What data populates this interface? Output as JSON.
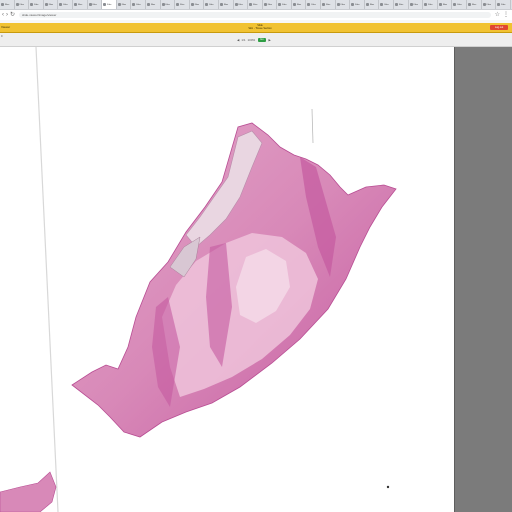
{
  "browser": {
    "tabs": [
      {
        "title": "Files",
        "active": false
      },
      {
        "title": "Files",
        "active": false
      },
      {
        "title": "Files",
        "active": false
      },
      {
        "title": "Files",
        "active": false
      },
      {
        "title": "Files",
        "active": false
      },
      {
        "title": "Files",
        "active": false
      },
      {
        "title": "Files",
        "active": false
      },
      {
        "title": "Files",
        "active": true
      },
      {
        "title": "Files",
        "active": false
      },
      {
        "title": "Files",
        "active": false
      },
      {
        "title": "Files",
        "active": false
      },
      {
        "title": "Files",
        "active": false
      },
      {
        "title": "Files",
        "active": false
      },
      {
        "title": "Files",
        "active": false
      },
      {
        "title": "Files",
        "active": false
      },
      {
        "title": "Files",
        "active": false
      },
      {
        "title": "Files",
        "active": false
      },
      {
        "title": "Files",
        "active": false
      },
      {
        "title": "Files",
        "active": false
      },
      {
        "title": "Files",
        "active": false
      },
      {
        "title": "Files",
        "active": false
      },
      {
        "title": "Files",
        "active": false
      },
      {
        "title": "Files",
        "active": false
      },
      {
        "title": "Files",
        "active": false
      },
      {
        "title": "Files",
        "active": false
      },
      {
        "title": "Files",
        "active": false
      },
      {
        "title": "Files",
        "active": false
      },
      {
        "title": "Files",
        "active": false
      },
      {
        "title": "Files",
        "active": false
      },
      {
        "title": "Files",
        "active": false
      },
      {
        "title": "Files",
        "active": false
      },
      {
        "title": "Files",
        "active": false
      },
      {
        "title": "Files",
        "active": false
      },
      {
        "title": "Files",
        "active": false
      },
      {
        "title": "Files",
        "active": false
      }
    ],
    "url": "slide-viewer/image/viewer"
  },
  "header": {
    "logo": "Viewer",
    "caption_line1": "Slide",
    "caption_line2": "Skin - Tissue Section",
    "logout_label": "Log out",
    "accent": "#f1c232",
    "logout_color": "#e0462f"
  },
  "toolbar": {
    "menu_label": "≡",
    "prev_label": "◀",
    "position_text": "1/1",
    "zoom_text": "100%",
    "go_label": "Go",
    "next_label": "▶",
    "go_color": "#2f9e44"
  },
  "viewer": {
    "tissue_colors": {
      "pink": "#d889b8",
      "deep": "#c55aa0",
      "pale": "#efc3db"
    }
  }
}
